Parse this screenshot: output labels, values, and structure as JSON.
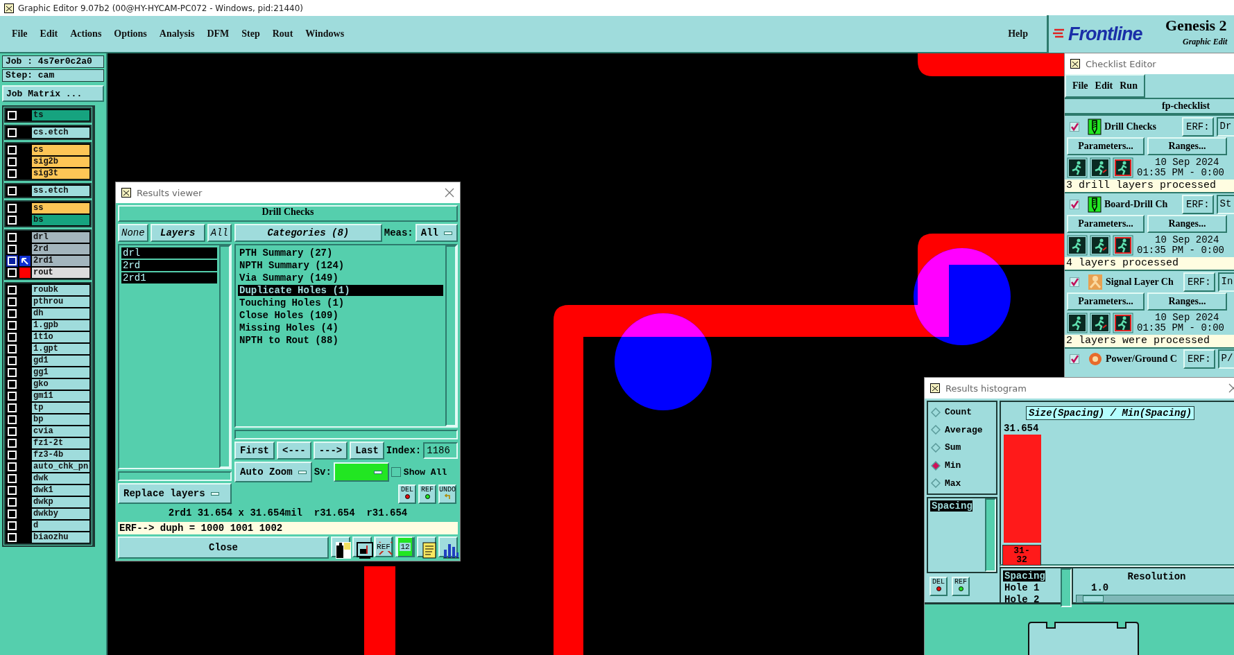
{
  "window": {
    "title": "Graphic Editor 9.07b2 (00@HY-HYCAM-PC072 - Windows, pid:21440)"
  },
  "menu": [
    "File",
    "Edit",
    "Actions",
    "Options",
    "Analysis",
    "DFM",
    "Step",
    "Rout",
    "Windows"
  ],
  "help": "Help",
  "logo": {
    "brand": "Frontline",
    "product": "Genesis 2",
    "subtitle": "Graphic Edit"
  },
  "job": {
    "job": "Job : 4s7er0c2a0",
    "step": "Step: cam",
    "matrix_button": "Job Matrix ..."
  },
  "layer_groups": [
    {
      "layers": [
        {
          "name": "ts",
          "color": "#16a37f",
          "work": false,
          "displayed": false
        }
      ]
    },
    {
      "layers": [
        {
          "name": "cs.etch",
          "color": "#9fdcdc",
          "work": false,
          "displayed": false
        }
      ]
    },
    {
      "layers": [
        {
          "name": "cs",
          "color": "#fdc556",
          "work": false,
          "displayed": false
        },
        {
          "name": "sig2b",
          "color": "#fdc556",
          "work": false,
          "displayed": false
        },
        {
          "name": "sig3t",
          "color": "#fdc556",
          "work": false,
          "displayed": false
        }
      ]
    },
    {
      "layers": [
        {
          "name": "ss.etch",
          "color": "#9fdcdc",
          "work": false,
          "displayed": false
        }
      ]
    },
    {
      "layers": [
        {
          "name": "ss",
          "color": "#fdc556",
          "work": false,
          "displayed": false
        },
        {
          "name": "bs",
          "color": "#16a37f",
          "work": false,
          "displayed": false
        }
      ]
    },
    {
      "layers": [
        {
          "name": "drl",
          "color": "#a3b5bd",
          "work": false,
          "displayed": false
        },
        {
          "name": "2rd",
          "color": "#a3b5bd",
          "work": false,
          "displayed": false
        },
        {
          "name": "2rd1",
          "color": "#a3b5bd",
          "work": true,
          "displayed": false
        },
        {
          "name": "rout",
          "color": "#dcdcdc",
          "work": false,
          "displayed": true
        }
      ]
    },
    {
      "layers": [
        {
          "name": "roubk",
          "color": "#9fdcdc",
          "work": false,
          "displayed": false
        },
        {
          "name": "pthrou",
          "color": "#9fdcdc",
          "work": false,
          "displayed": false
        },
        {
          "name": "dh",
          "color": "#9fdcdc",
          "work": false,
          "displayed": false
        },
        {
          "name": "1.gpb",
          "color": "#9fdcdc",
          "work": false,
          "displayed": false
        },
        {
          "name": "1t1o",
          "color": "#9fdcdc",
          "work": false,
          "displayed": false
        },
        {
          "name": "1.gpt",
          "color": "#9fdcdc",
          "work": false,
          "displayed": false
        },
        {
          "name": "gd1",
          "color": "#9fdcdc",
          "work": false,
          "displayed": false
        },
        {
          "name": "gg1",
          "color": "#9fdcdc",
          "work": false,
          "displayed": false
        },
        {
          "name": "gko",
          "color": "#9fdcdc",
          "work": false,
          "displayed": false
        },
        {
          "name": "gm11",
          "color": "#9fdcdc",
          "work": false,
          "displayed": false
        },
        {
          "name": "tp",
          "color": "#9fdcdc",
          "work": false,
          "displayed": false
        },
        {
          "name": "bp",
          "color": "#9fdcdc",
          "work": false,
          "displayed": false
        },
        {
          "name": "cvia",
          "color": "#9fdcdc",
          "work": false,
          "displayed": false
        },
        {
          "name": "fz1-2t",
          "color": "#9fdcdc",
          "work": false,
          "displayed": false
        },
        {
          "name": "fz3-4b",
          "color": "#9fdcdc",
          "work": false,
          "displayed": false
        },
        {
          "name": "auto_chk_pn",
          "color": "#9fdcdc",
          "work": false,
          "displayed": false
        },
        {
          "name": "dwk",
          "color": "#9fdcdc",
          "work": false,
          "displayed": false
        },
        {
          "name": "dwk1",
          "color": "#9fdcdc",
          "work": false,
          "displayed": false
        },
        {
          "name": "dwkp",
          "color": "#9fdcdc",
          "work": false,
          "displayed": false
        },
        {
          "name": "dwkby",
          "color": "#9fdcdc",
          "work": false,
          "displayed": false
        },
        {
          "name": "d",
          "color": "#9fdcdc",
          "work": false,
          "displayed": false
        },
        {
          "name": "biaozhu",
          "color": "#9fdcdc",
          "work": false,
          "displayed": false
        }
      ]
    }
  ],
  "results_viewer": {
    "title": "Results viewer",
    "heading": "Drill Checks",
    "layer_buttons": [
      "None",
      "Layers",
      "All"
    ],
    "layers": [
      {
        "name": "drl",
        "selected": true
      },
      {
        "name": "2rd",
        "selected": true
      },
      {
        "name": "2rd1",
        "selected": true
      }
    ],
    "categories_title": "Categories (8)",
    "meas_label": "Meas:",
    "meas_value": "All",
    "categories": [
      {
        "label": "PTH Summary (27)",
        "selected": false
      },
      {
        "label": "NPTH Summary (124)",
        "selected": false
      },
      {
        "label": "Via Summary (149)",
        "selected": false
      },
      {
        "label": "Duplicate Holes (1)",
        "selected": true
      },
      {
        "label": "Touching Holes (1)",
        "selected": false
      },
      {
        "label": "Close Holes (109)",
        "selected": false
      },
      {
        "label": "Missing Holes (4)",
        "selected": false
      },
      {
        "label": "NPTH to Rout (88)",
        "selected": false
      }
    ],
    "nav": [
      "First",
      "<---",
      "--->",
      "Last"
    ],
    "index_label": "Index:",
    "index_value": "1186",
    "zoom": "Auto Zoom",
    "sv_label": "Sv:",
    "show_all": {
      "label": "Show All",
      "checked": false
    },
    "replace": "Replace layers",
    "actions": [
      {
        "kind": "del",
        "label": "DEL"
      },
      {
        "kind": "ref",
        "label": "REF"
      },
      {
        "kind": "undo",
        "label": "UNDO"
      }
    ],
    "status": "2rd1 31.654 x 31.654mil  r31.654  r31.654",
    "erf": "ERF--> duph = 1000 1001 1002",
    "close": "Close",
    "tools": [
      {
        "kind": "figure"
      },
      {
        "kind": "monitor"
      },
      {
        "kind": "crossed",
        "label": "REF"
      },
      {
        "kind": "numbers",
        "label": "12"
      },
      {
        "kind": "report"
      },
      {
        "kind": "chart"
      }
    ]
  },
  "checklist_editor": {
    "title": "Checklist Editor",
    "menu": [
      "File",
      "Edit",
      "Run"
    ],
    "name": "fp-checklist",
    "checks": [
      {
        "checked": true,
        "kind": "drill",
        "name": "Drill Checks",
        "erf_label": "ERF:",
        "erf_value": "Dr",
        "parameters": "Parameters...",
        "ranges": "Ranges...",
        "date": "10 Sep 2024",
        "time": "01:35 PM - 0:00",
        "status": "3 drill layers processed"
      },
      {
        "checked": true,
        "kind": "drill",
        "name": "Board-Drill Ch",
        "erf_label": "ERF:",
        "erf_value": "St",
        "parameters": "Parameters...",
        "ranges": "Ranges...",
        "date": "10 Sep 2024",
        "time": "01:35 PM - 0:00",
        "status": "4 layers processed"
      },
      {
        "checked": true,
        "kind": "signal",
        "name": "Signal Layer Ch",
        "erf_label": "ERF:",
        "erf_value": "In",
        "parameters": "Parameters...",
        "ranges": "Ranges...",
        "date": "10 Sep 2024",
        "time": "01:35 PM - 0:00",
        "status": "2 layers were processed"
      },
      {
        "checked": true,
        "kind": "power",
        "name": "Power/Ground C",
        "erf_label": "ERF:",
        "erf_value": "P/"
      }
    ]
  },
  "histogram": {
    "title": "Results histogram",
    "modes": [
      {
        "label": "Count",
        "selected": false
      },
      {
        "label": "Average",
        "selected": false
      },
      {
        "label": "Sum",
        "selected": false
      },
      {
        "label": "Min",
        "selected": true
      },
      {
        "label": "Max",
        "selected": false
      }
    ],
    "attributes": [
      {
        "label": "Spacing",
        "selected": true
      }
    ],
    "actions": [
      {
        "kind": "del",
        "label": "DEL"
      },
      {
        "kind": "ref",
        "label": "REF"
      }
    ],
    "chart": {
      "title": "Size(Spacing) / Min(Spacing)",
      "bars": [
        {
          "value_label": "31.654",
          "category": "31-32"
        }
      ]
    },
    "fields": [
      {
        "label": "Spacing",
        "selected": true
      },
      {
        "label": "Hole 1",
        "selected": false
      },
      {
        "label": "Hole 2",
        "selected": false
      }
    ],
    "resolution": {
      "label": "Resolution",
      "value": "1.0",
      "level": 0.04
    }
  }
}
